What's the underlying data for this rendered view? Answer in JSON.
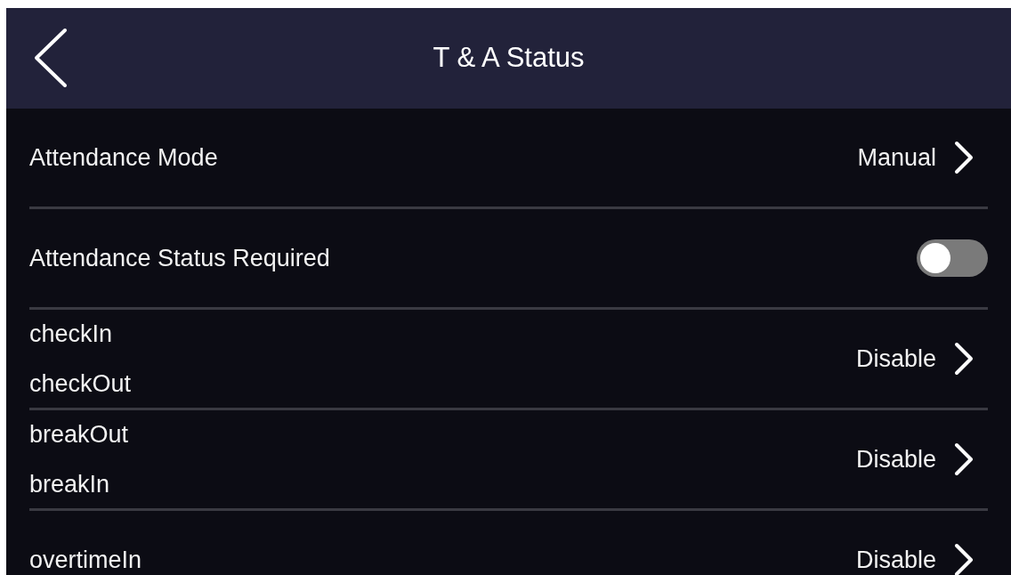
{
  "header": {
    "title": "T & A Status"
  },
  "rows": [
    {
      "kind": "select",
      "labels": [
        "Attendance Mode"
      ],
      "value": "Manual"
    },
    {
      "kind": "toggle",
      "labels": [
        "Attendance Status Required"
      ],
      "on": false
    },
    {
      "kind": "select",
      "labels": [
        "checkIn",
        "checkOut"
      ],
      "value": "Disable"
    },
    {
      "kind": "select",
      "labels": [
        "breakOut",
        "breakIn"
      ],
      "value": "Disable"
    },
    {
      "kind": "select",
      "labels": [
        "overtimeIn"
      ],
      "value": "Disable"
    }
  ]
}
